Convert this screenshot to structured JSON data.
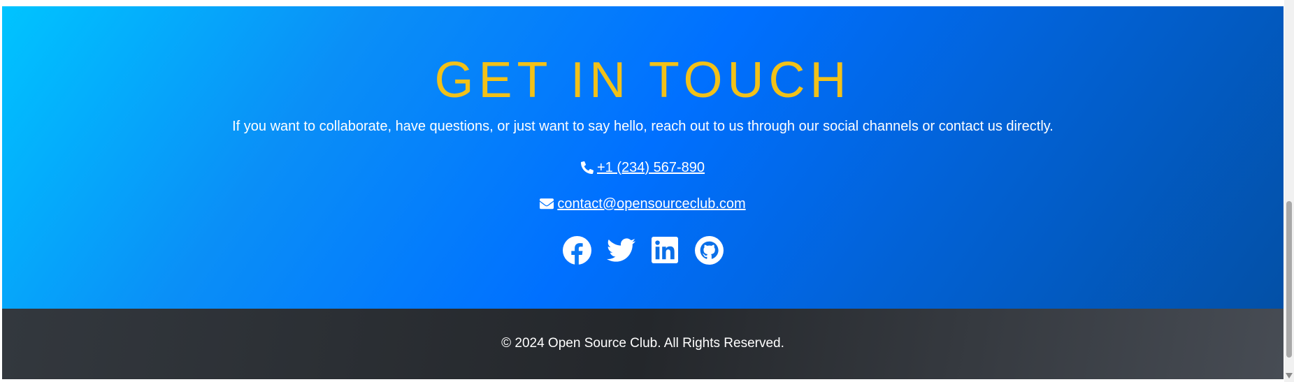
{
  "contact": {
    "title": "GET IN TOUCH",
    "intro": "If you want to collaborate, have questions, or just want to say hello, reach out to us through our social channels or contact us directly.",
    "phone": {
      "icon": "phone-icon",
      "label": "+1 (234) 567-890"
    },
    "email": {
      "icon": "envelope-icon",
      "label": "contact@opensourceclub.com"
    },
    "social": [
      {
        "name": "facebook",
        "icon": "facebook-icon"
      },
      {
        "name": "twitter",
        "icon": "twitter-icon"
      },
      {
        "name": "linkedin",
        "icon": "linkedin-icon"
      },
      {
        "name": "github",
        "icon": "github-icon"
      }
    ],
    "colors": {
      "title": "#f2c118",
      "gradient_start": "#00c4ff",
      "gradient_mid": "#0070ff",
      "gradient_end": "#0350a6",
      "text": "#ffffff"
    }
  },
  "footer": {
    "copyright": "© 2024 Open Source Club. All Rights Reserved.",
    "colors": {
      "background": "#24272b",
      "text": "#ffffff"
    }
  }
}
